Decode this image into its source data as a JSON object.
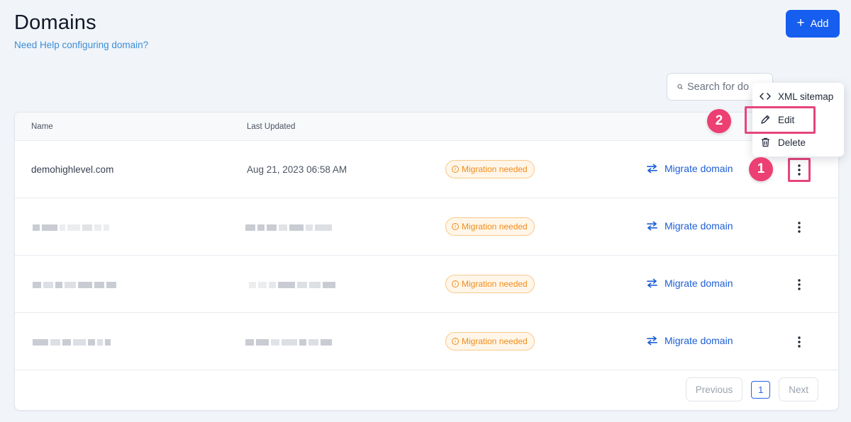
{
  "header": {
    "title": "Domains",
    "help_link": "Need Help configuring domain?",
    "add_label": "Add"
  },
  "search": {
    "placeholder": "Search for do"
  },
  "table": {
    "columns": [
      "Name",
      "Last Updated"
    ],
    "rows": [
      {
        "name": "demohighlevel.com",
        "last_updated": "Aug 21, 2023 06:58 AM",
        "status": "Migration needed",
        "action": "Migrate domain"
      },
      {
        "name": "",
        "last_updated": "",
        "status": "Migration needed",
        "action": "Migrate domain"
      },
      {
        "name": "",
        "last_updated": "",
        "status": "Migration needed",
        "action": "Migrate domain"
      },
      {
        "name": "",
        "last_updated": "",
        "status": "Migration needed",
        "action": "Migrate domain"
      }
    ]
  },
  "pagination": {
    "previous": "Previous",
    "current_page": "1",
    "next": "Next"
  },
  "context_menu": {
    "items": [
      {
        "label": "XML sitemap",
        "icon": "code-icon"
      },
      {
        "label": "Edit",
        "icon": "pencil-icon"
      },
      {
        "label": "Delete",
        "icon": "trash-icon"
      }
    ]
  },
  "annotations": {
    "step_1": "1",
    "step_2": "2"
  },
  "colors": {
    "primary": "#155eef",
    "link": "#1d5fd6",
    "warning": "#f08c1a",
    "annotation": "#ec3f72"
  }
}
